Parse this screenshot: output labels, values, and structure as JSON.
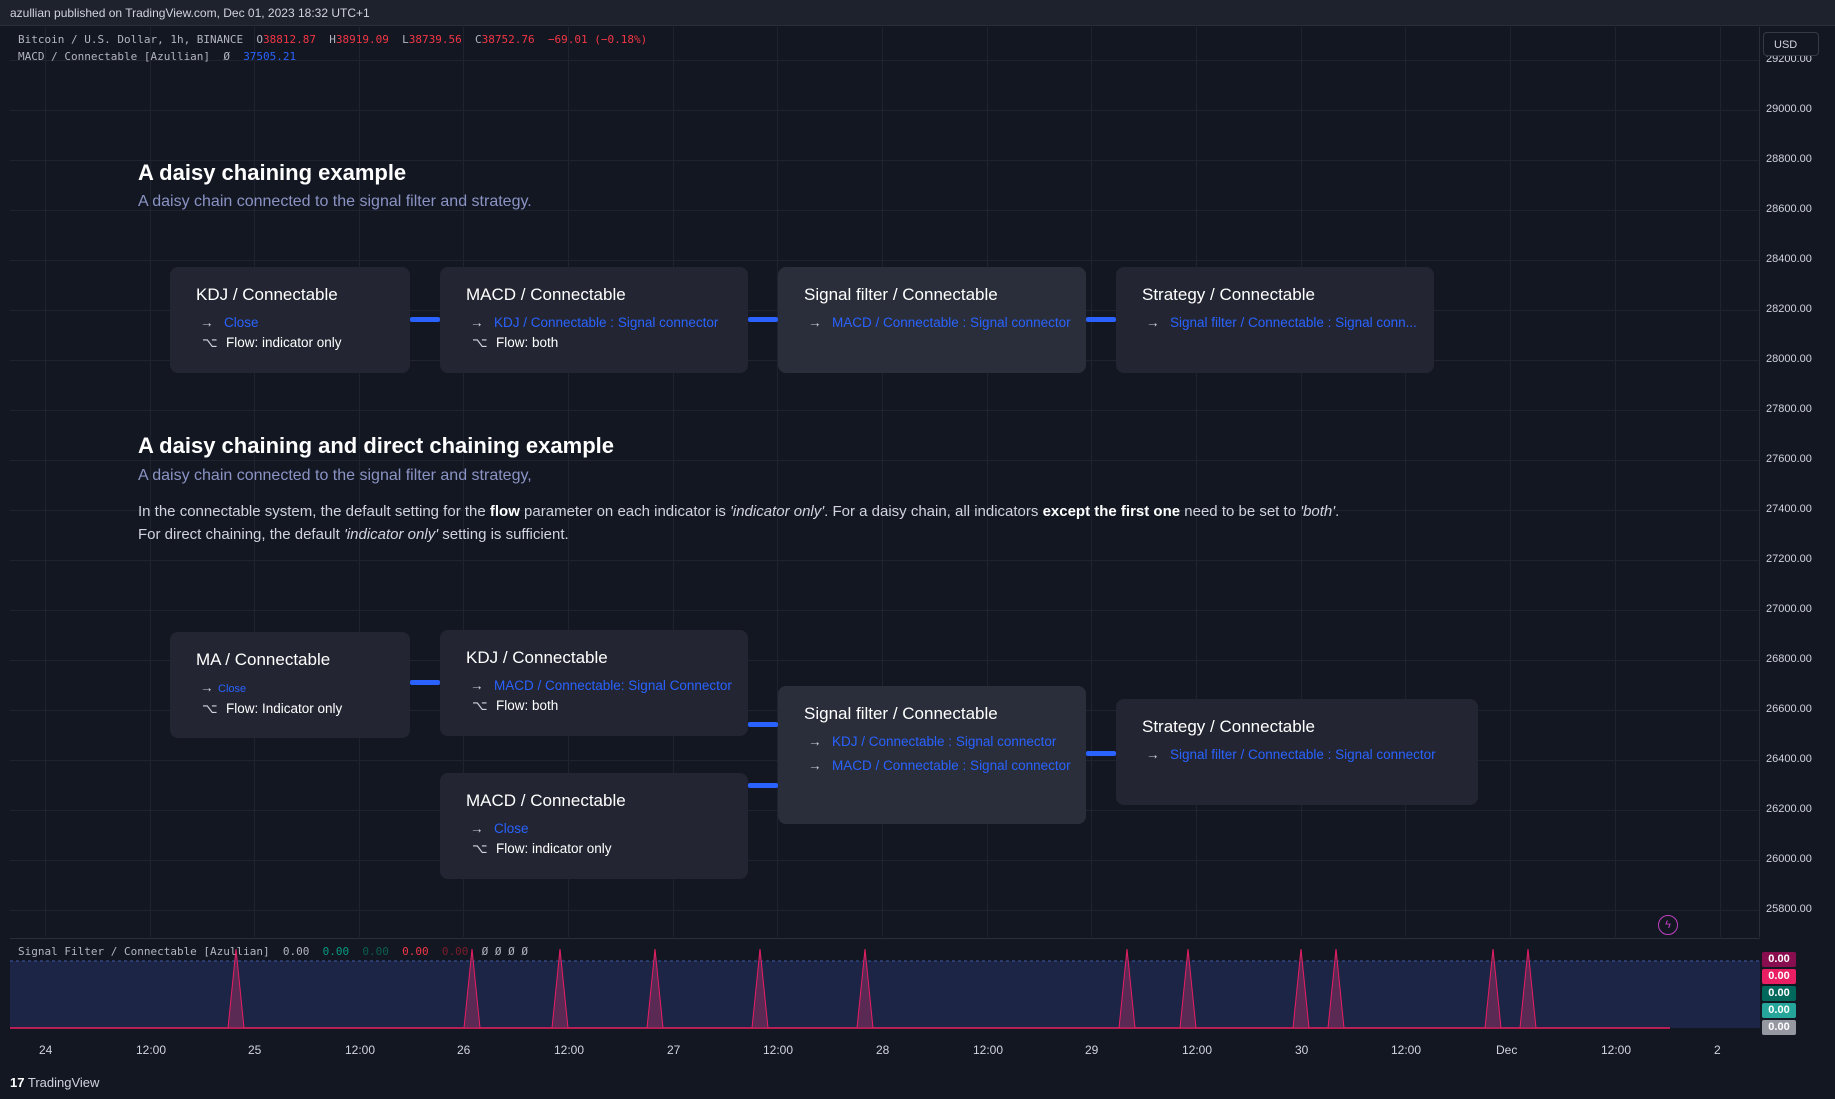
{
  "topbar": {
    "text": "azullian published on TradingView.com, Dec 01, 2023 18:32 UTC+1"
  },
  "legend": {
    "symbol": "Bitcoin / U.S. Dollar, 1h, BINANCE",
    "o_label": "O",
    "o": "38812.87",
    "h_label": "H",
    "h": "38919.09",
    "l_label": "L",
    "l": "38739.56",
    "c_label": "C",
    "c": "38752.76",
    "change": "−69.01 (−0.18%)",
    "indicator": "MACD / Connectable [Azullian]",
    "indicator_symbol": "Ø",
    "indicator_value": "37505.21"
  },
  "currency_button": "USD",
  "price_ticks": [
    "29200.00",
    "29000.00",
    "28800.00",
    "28600.00",
    "28400.00",
    "28200.00",
    "28000.00",
    "27800.00",
    "27600.00",
    "27400.00",
    "27200.00",
    "27000.00",
    "26800.00",
    "26600.00",
    "26400.00",
    "26200.00",
    "26000.00",
    "25800.00"
  ],
  "section1": {
    "title": "A daisy chaining example",
    "subtitle": "A daisy chain connected to the signal filter and strategy."
  },
  "section1_cards": [
    {
      "title": "KDJ / Connectable",
      "arrow": "→",
      "link": "Close",
      "flow_icon": "⌥",
      "flow": "Flow: indicator only"
    },
    {
      "title": "MACD / Connectable",
      "arrow": "→",
      "link": "KDJ / Connectable : Signal connector",
      "flow_icon": "⌥",
      "flow": "Flow: both"
    },
    {
      "title": "Signal filter / Connectable",
      "arrow": "→",
      "link": "MACD / Connectable : Signal connector"
    },
    {
      "title": "Strategy / Connectable",
      "arrow": "→",
      "link": "Signal filter / Connectable : Signal conn..."
    }
  ],
  "section2": {
    "title": "A daisy chaining and direct chaining example",
    "subtitle": "A daisy chain connected to the signal filter and strategy,",
    "p1_a": "In the connectable system, the default setting for the ",
    "p1_b": "flow",
    "p1_c": " parameter on each indicator is ",
    "p1_d": "'indicator only'",
    "p1_e": ". For a daisy chain, all indicators ",
    "p1_f": "except the first one",
    "p1_g": " need to be set to ",
    "p1_h": "'both'",
    "p1_i": ".",
    "p2_a": "For direct chaining, the default ",
    "p2_b": "'indicator only'",
    "p2_c": " setting is sufficient."
  },
  "section2_cards": {
    "ma": {
      "title": "MA / Connectable",
      "arrow": "→",
      "link": "Close",
      "flow_icon": "⌥",
      "flow": "Flow: Indicator only"
    },
    "kdj": {
      "title": "KDJ / Connectable",
      "arrow": "→",
      "link": "MACD / Connectable: Signal Connector",
      "flow_icon": "⌥",
      "flow": "Flow: both"
    },
    "macd": {
      "title": "MACD / Connectable",
      "arrow": "→",
      "link": "Close",
      "flow_icon": "⌥",
      "flow": "Flow: indicator only"
    },
    "signal": {
      "title": "Signal filter / Connectable",
      "arrow": "→",
      "link1": "KDJ / Connectable : Signal connector",
      "link2": "MACD / Connectable : Signal connector"
    },
    "strategy": {
      "title": "Strategy / Connectable",
      "arrow": "→",
      "link": "Signal filter / Connectable : Signal connector"
    }
  },
  "pane_legend": {
    "name": "Signal Filter / Connectable [Azullian]",
    "v1": "0.00",
    "v2": "0.00",
    "v3": "0.00",
    "v4": "0.00",
    "v5": "0.00",
    "rest": "Ø Ø Ø Ø"
  },
  "pane_tags": [
    {
      "value": "0.00",
      "color": "#880e4f"
    },
    {
      "value": "0.00",
      "color": "#e91e63"
    },
    {
      "value": "0.00",
      "color": "#00695c"
    },
    {
      "value": "0.00",
      "color": "#26a69a"
    },
    {
      "value": "0.00",
      "color": "#9598a1"
    }
  ],
  "time_ticks": [
    "24",
    "12:00",
    "25",
    "12:00",
    "26",
    "12:00",
    "27",
    "12:00",
    "28",
    "12:00",
    "29",
    "12:00",
    "30",
    "12:00",
    "Dec",
    "12:00",
    "2"
  ],
  "footer": {
    "logo": "17",
    "brand": "TradingView"
  },
  "colors": {
    "link": "#2962ff",
    "background": "#131722",
    "card": "#232632",
    "spike": "#e91e63"
  }
}
